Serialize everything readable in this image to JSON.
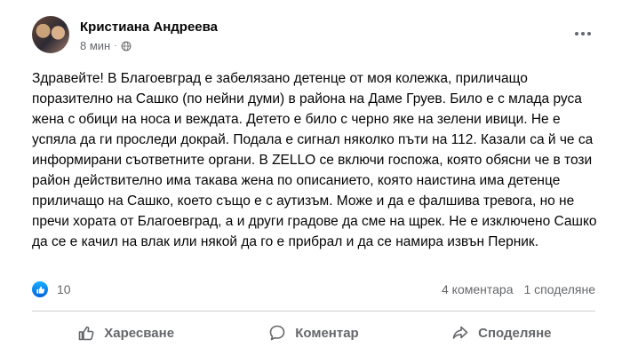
{
  "post": {
    "author": "Кристиана Андреева",
    "time": "8 мин",
    "separator": "·",
    "text": "Здравейте! В Благоевград е забелязано детенце от моя колежка, приличащо поразително на Сашко (по нейни думи) в района на Даме Груев. Било е с млада руса жена с обици на носа и веждата. Детето е било с черно яке на зелени ивици. Не е успяла да ги проследи докрай. Подала е сигнал няколко пъти на 112. Казали са й че са информирани съответните органи. В ZELLO се включи госпожа, която обясни че в този район действително има такава жена по описанието, която наистина има детенце приличащо на Сашко, което също е с аутизъм. Може и да е фалшива тревога, но не пречи хората от Благоевград, а и други градове да сме на щрек. Не е изключено Сашко да се е качил на влак или някой да го е прибрал и да се намира извън Перник.",
    "audience_icon": "globe-icon",
    "more_icon": "more-options-icon"
  },
  "stats": {
    "reactions": "10",
    "comments": "4 коментара",
    "shares": "1 споделяне"
  },
  "actions": {
    "like": "Харесване",
    "comment": "Коментар",
    "share": "Споделяне"
  },
  "colors": {
    "secondary_text": "#65676b",
    "like_blue": "#1877f2",
    "divider": "#ced0d4"
  }
}
